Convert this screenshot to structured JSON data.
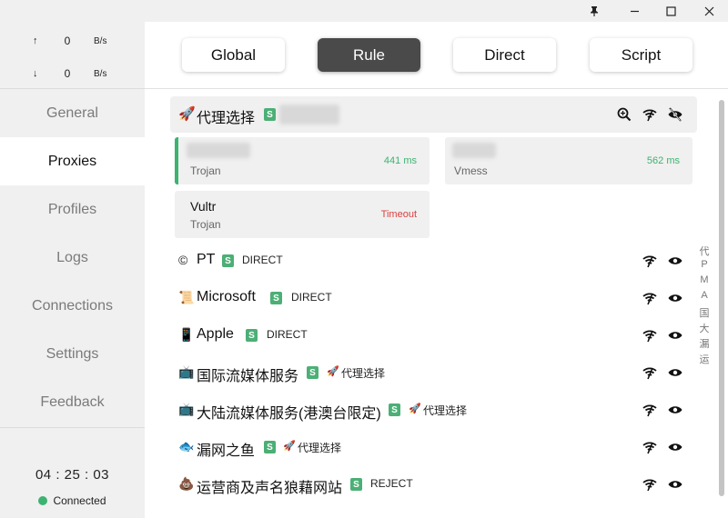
{
  "window": {
    "pin_icon": "pin-icon",
    "minimize_icon": "minimize-icon",
    "maximize_icon": "maximize-icon",
    "close_icon": "close-icon"
  },
  "traffic": {
    "up_arrow": "↑",
    "up_value": "0",
    "up_unit": "B/s",
    "down_arrow": "↓",
    "down_value": "0",
    "down_unit": "B/s"
  },
  "sidebar": {
    "items": [
      {
        "label": "General"
      },
      {
        "label": "Proxies"
      },
      {
        "label": "Profiles"
      },
      {
        "label": "Logs"
      },
      {
        "label": "Connections"
      },
      {
        "label": "Settings"
      },
      {
        "label": "Feedback"
      }
    ],
    "active": "Proxies"
  },
  "footer": {
    "clock": "04 : 25 : 03",
    "status": "Connected",
    "status_color": "#3cb371"
  },
  "modes": [
    {
      "label": "Global",
      "active": false
    },
    {
      "label": "Rule",
      "active": true
    },
    {
      "label": "Direct",
      "active": false
    },
    {
      "label": "Script",
      "active": false
    }
  ],
  "selected_group": {
    "emoji": "🚀",
    "name": "代理选择",
    "badge": "S",
    "icons": [
      "latency-check-icon",
      "wifi-icon",
      "hide-icon"
    ]
  },
  "nodes": [
    {
      "name": "",
      "type": "Trojan",
      "delay": "441 ms",
      "selected": true
    },
    {
      "name": "",
      "type": "Vmess",
      "delay": "562 ms",
      "selected": false
    },
    {
      "name": "Vultr",
      "type": "Trojan",
      "delay": "Timeout",
      "selected": false
    }
  ],
  "groups": [
    {
      "emoji": "©",
      "name": "PT",
      "badge": "S",
      "now_emoji": "",
      "now": "DIRECT"
    },
    {
      "emoji": "📜",
      "name": "Microsoft",
      "badge": "S",
      "now_emoji": "",
      "now": "DIRECT"
    },
    {
      "emoji": "📱",
      "name": "Apple",
      "badge": "S",
      "now_emoji": "",
      "now": "DIRECT"
    },
    {
      "emoji": "📺",
      "name": "国际流媒体服务",
      "badge": "S",
      "now_emoji": "🚀",
      "now": "代理选择"
    },
    {
      "emoji": "📺",
      "name": "大陆流媒体服务(港澳台限定)",
      "badge": "S",
      "now_emoji": "🚀",
      "now": "代理选择"
    },
    {
      "emoji": "🐟",
      "name": "漏网之鱼",
      "badge": "S",
      "now_emoji": "🚀",
      "now": "代理选择"
    },
    {
      "emoji": "💩",
      "name": "运营商及声名狼藉网站",
      "badge": "S",
      "now_emoji": "",
      "now": "REJECT"
    }
  ],
  "index_letters": [
    "代",
    "P",
    "M",
    "A",
    "国",
    "大",
    "漏",
    "运"
  ],
  "colors": {
    "accent_green": "#3cb371",
    "badge_green": "#4caf76",
    "timeout_red": "#d94040",
    "active_mode_bg": "#4a4a4a"
  }
}
